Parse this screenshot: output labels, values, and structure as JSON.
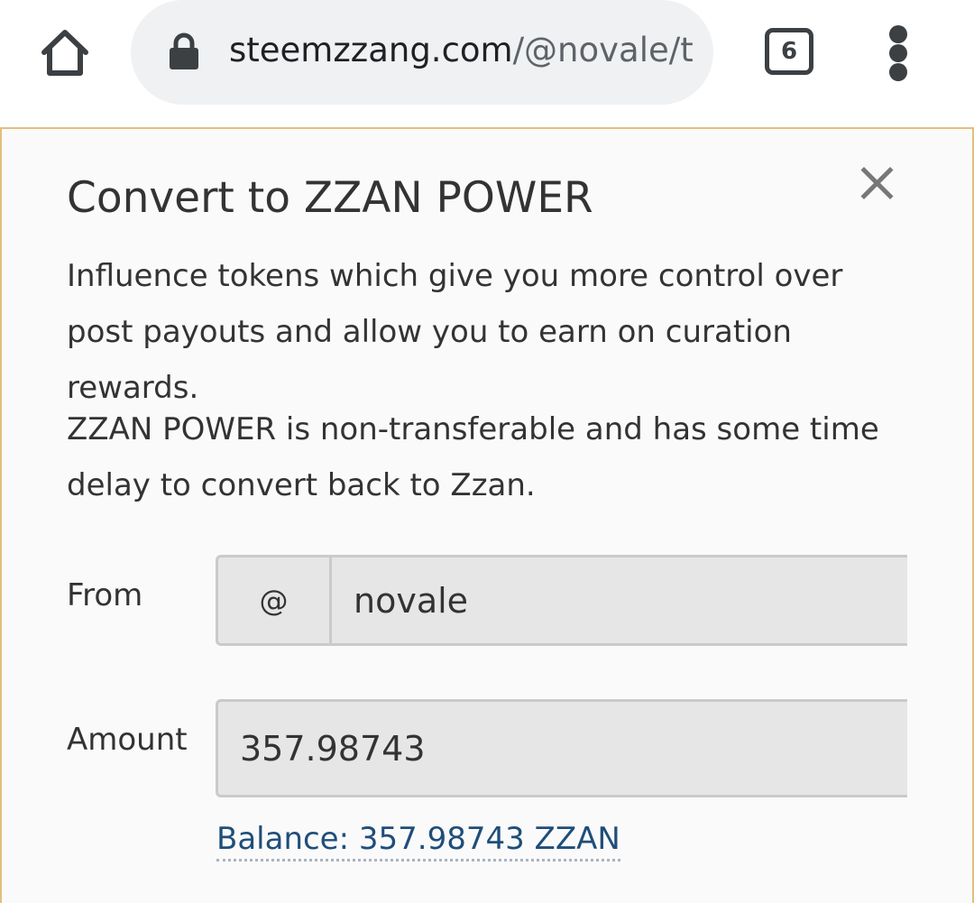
{
  "browser": {
    "url_host": "steemzzang.com",
    "url_path": "/@novale/trans",
    "tab_count": "6",
    "icons": {
      "home": "home-icon",
      "lock": "lock-icon",
      "tabs": "tab-switcher-icon",
      "menu": "more-vert-icon"
    }
  },
  "modal": {
    "title": "Convert to ZZAN POWER",
    "close_icon": "close-icon",
    "description_1": "Influence tokens which give you more control over post payouts and allow you to earn on curation rewards.",
    "description_2": "ZZAN POWER is non-transferable and has some time delay to convert back to Zzan.",
    "from": {
      "label": "From",
      "prefix": "@",
      "value": "novale"
    },
    "amount": {
      "label": "Amount",
      "value": "357.98743"
    },
    "balance_link": "Balance: 357.98743 ZZAN"
  },
  "colors": {
    "page_border": "#e3bf7a",
    "link": "#1f4e79",
    "input_bg": "#e6e6e6"
  }
}
